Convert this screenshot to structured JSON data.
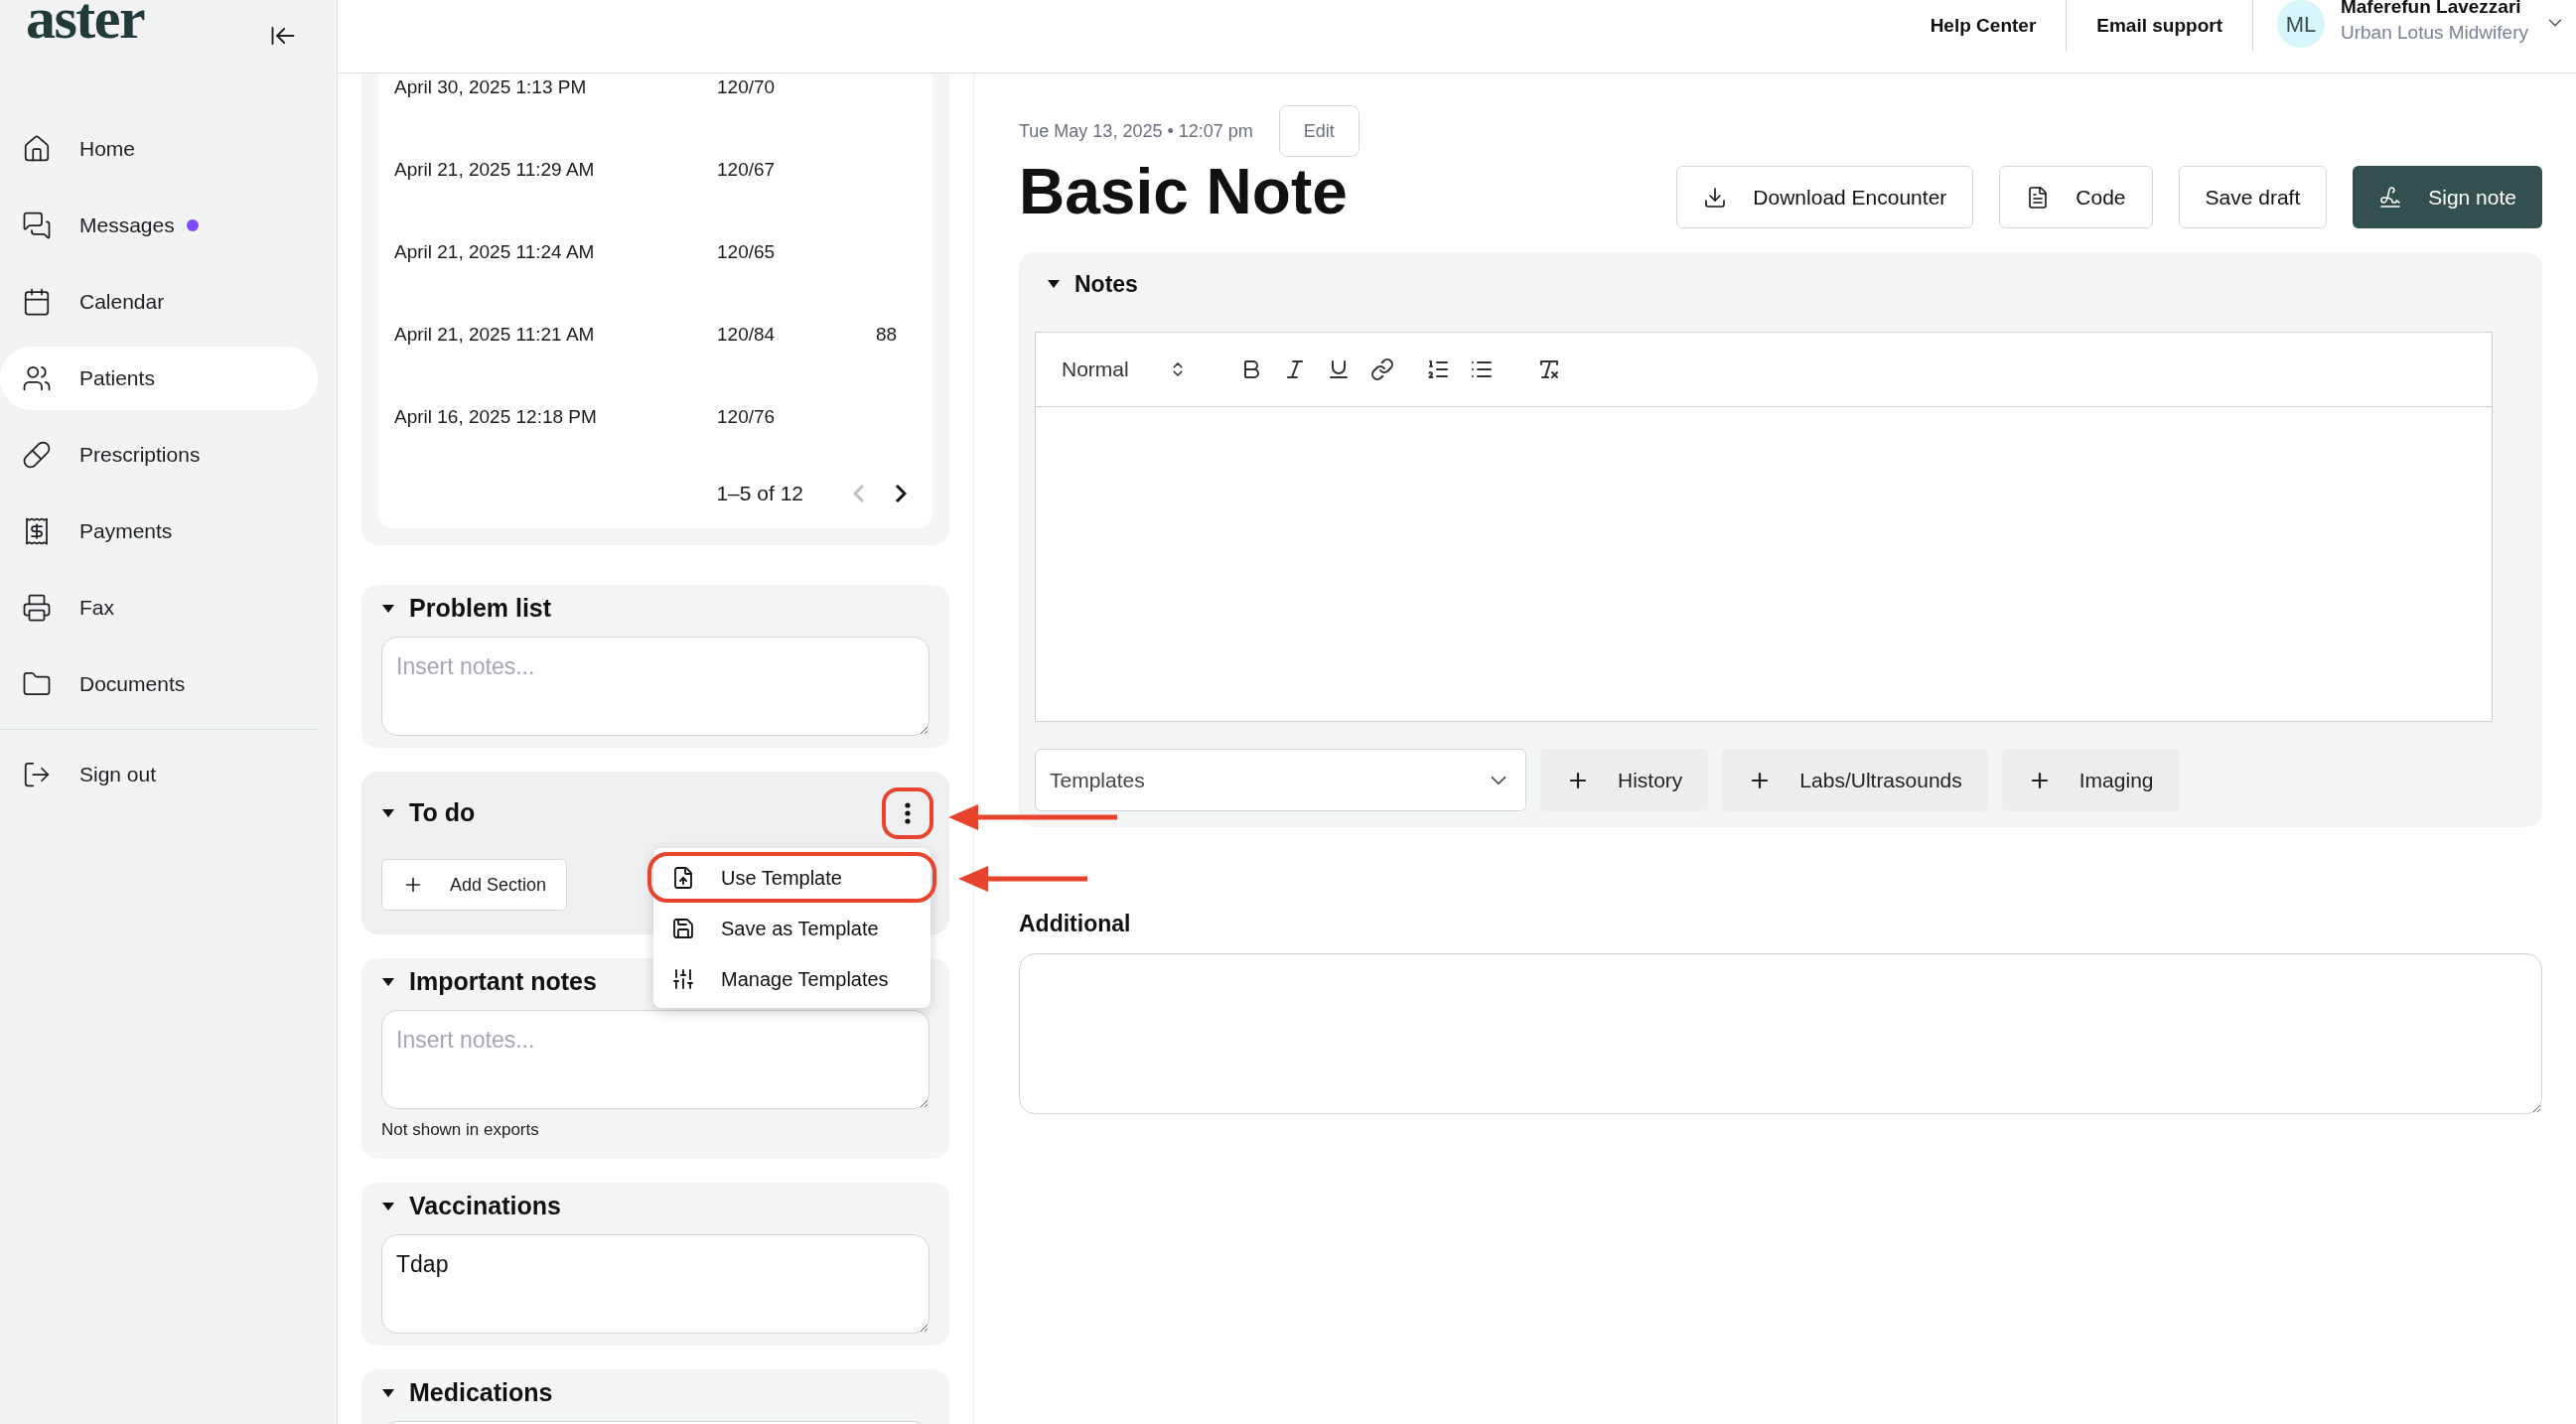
{
  "sidebar": {
    "logo": "aster",
    "items": [
      {
        "label": "Home",
        "selected": false,
        "unread": false
      },
      {
        "label": "Messages",
        "selected": false,
        "unread": true
      },
      {
        "label": "Calendar",
        "selected": false,
        "unread": false
      },
      {
        "label": "Patients",
        "selected": true,
        "unread": false
      },
      {
        "label": "Prescriptions",
        "selected": false,
        "unread": false
      },
      {
        "label": "Payments",
        "selected": false,
        "unread": false
      },
      {
        "label": "Fax",
        "selected": false,
        "unread": false
      },
      {
        "label": "Documents",
        "selected": false,
        "unread": false
      }
    ],
    "sign_out": "Sign out"
  },
  "header": {
    "links": [
      "Help Center",
      "Email support"
    ],
    "user": {
      "initials": "ML",
      "name": "Maferefun Lavezzari",
      "organization": "Urban Lotus Midwifery"
    }
  },
  "vitals": {
    "rows": [
      {
        "date": "April 30, 2025 1:13 PM",
        "blood_pressure": "120/70",
        "column_3": ""
      },
      {
        "date": "April 21, 2025 11:29 AM",
        "blood_pressure": "120/67",
        "column_3": ""
      },
      {
        "date": "April 21, 2025 11:24 AM",
        "blood_pressure": "120/65",
        "column_3": ""
      },
      {
        "date": "April 21, 2025 11:21 AM",
        "blood_pressure": "120/84",
        "column_3": "88"
      },
      {
        "date": "April 16, 2025 12:18 PM",
        "blood_pressure": "120/76",
        "column_3": ""
      }
    ],
    "pagination": "1–5 of 12",
    "prev_disabled": true,
    "next_disabled": false
  },
  "sections": [
    {
      "kind": "notes",
      "title": "Problem list",
      "expanded": true,
      "placeholder": "Insert notes..."
    },
    {
      "kind": "actions",
      "title": "To do",
      "expanded": true,
      "add_button": "Add Section",
      "more_highlighted": true,
      "menu": {
        "open": true,
        "items": [
          {
            "label": "Use Template",
            "highlighted": true
          },
          {
            "label": "Save as Template",
            "highlighted": false
          },
          {
            "label": "Manage Templates",
            "highlighted": false
          }
        ]
      }
    },
    {
      "kind": "notes",
      "title": "Important notes",
      "expanded": true,
      "placeholder": "Insert notes...",
      "footnote": "Not shown in exports"
    },
    {
      "kind": "notes",
      "title": "Vaccinations",
      "expanded": true,
      "value": "Tdap"
    },
    {
      "kind": "notes",
      "title": "Medications",
      "expanded": true
    }
  ],
  "note": {
    "date": "Tue May 13, 2025 • 12:07 pm",
    "edit": "Edit",
    "title": "Basic Note",
    "buttons": [
      {
        "label": "Download Encounter",
        "primary": false
      },
      {
        "label": "Code",
        "primary": false
      },
      {
        "label": "Save draft",
        "primary": false
      },
      {
        "label": "Sign note",
        "primary": true
      }
    ],
    "notes_panel": {
      "title": "Notes",
      "expanded": true,
      "format": "Normal",
      "templates": "Templates",
      "add_buttons": [
        "History",
        "Labs/Ultrasounds",
        "Imaging"
      ]
    },
    "additional": {
      "label": "Additional"
    }
  }
}
